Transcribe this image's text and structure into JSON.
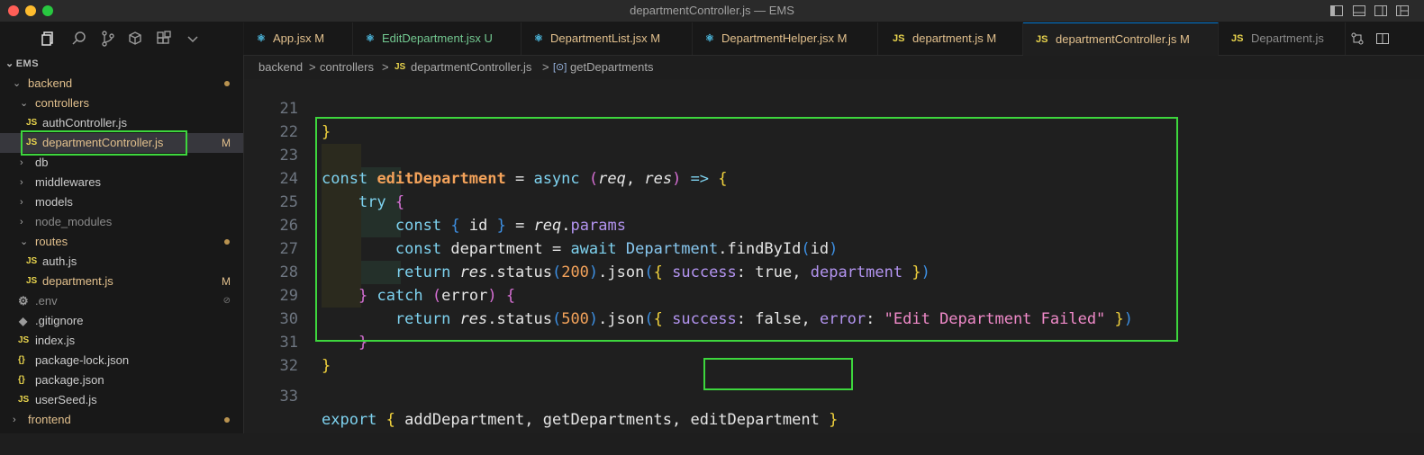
{
  "window": {
    "title": "departmentController.js — EMS"
  },
  "explorer": {
    "workspace": "EMS",
    "items": [
      {
        "label": "backend",
        "kind": "folder",
        "open": true,
        "status": "dot"
      },
      {
        "label": "controllers",
        "kind": "folder",
        "open": true
      },
      {
        "label": "authController.js",
        "kind": "js",
        "file_icon": "JS"
      },
      {
        "label": "departmentController.js",
        "kind": "js",
        "file_icon": "JS",
        "status": "M"
      },
      {
        "label": "db",
        "kind": "folder",
        "open": false
      },
      {
        "label": "middlewares",
        "kind": "folder",
        "open": false
      },
      {
        "label": "models",
        "kind": "folder",
        "open": false
      },
      {
        "label": "node_modules",
        "kind": "folder",
        "open": false
      },
      {
        "label": "routes",
        "kind": "folder",
        "open": true,
        "status": "dot"
      },
      {
        "label": "auth.js",
        "kind": "js",
        "file_icon": "JS"
      },
      {
        "label": "department.js",
        "kind": "js",
        "file_icon": "JS",
        "status": "M"
      },
      {
        "label": ".env",
        "kind": "gear",
        "status": "⊘"
      },
      {
        "label": ".gitignore",
        "kind": "git"
      },
      {
        "label": "index.js",
        "kind": "js",
        "file_icon": "JS"
      },
      {
        "label": "package-lock.json",
        "kind": "json",
        "file_icon": "{}"
      },
      {
        "label": "package.json",
        "kind": "json",
        "file_icon": "{}"
      },
      {
        "label": "userSeed.js",
        "kind": "js",
        "file_icon": "JS"
      },
      {
        "label": "frontend",
        "kind": "folder",
        "open": false,
        "status": "dot"
      }
    ]
  },
  "tabs": [
    {
      "label": "App.jsx",
      "status": "M",
      "icon": "react-icon"
    },
    {
      "label": "EditDepartment.jsx",
      "status": "U",
      "icon": "react-icon"
    },
    {
      "label": "DepartmentList.jsx",
      "status": "M",
      "icon": "react-icon"
    },
    {
      "label": "DepartmentHelper.jsx",
      "status": "M",
      "icon": "react-icon"
    },
    {
      "label": "department.js",
      "status": "M",
      "icon": "js-icon",
      "icon_text": "JS"
    },
    {
      "label": "departmentController.js",
      "status": "M",
      "icon": "js-icon",
      "icon_text": "JS",
      "active": true
    },
    {
      "label": "Department.js",
      "status": "",
      "icon": "js-icon",
      "icon_text": "JS"
    }
  ],
  "breadcrumb": {
    "parts": [
      "backend",
      "controllers",
      "departmentController.js",
      "getDepartments"
    ],
    "sep": ">",
    "file_icon": "JS",
    "symbol_icon": "[⊙]"
  },
  "code": {
    "line_numbers": [
      "21",
      "22",
      "23",
      "24",
      "25",
      "26",
      "27",
      "28",
      "29",
      "30",
      "31",
      "32",
      "33"
    ],
    "line21": "}",
    "line23": {
      "const": "const",
      "name": "editDepartment",
      "eq": " = ",
      "async": "async",
      "p1": "req",
      "p2": "res",
      "arrow": "=>"
    },
    "line24": "try",
    "line25": {
      "const": "const",
      "id": "id",
      "req": "req",
      "params": "params"
    },
    "line26": {
      "const": "const",
      "var": "department",
      "await": "await",
      "cls": "Department",
      "method": "findById",
      "arg": "id"
    },
    "line27": {
      "ret": "return",
      "res": "res",
      "status": "status",
      "code": "200",
      "json": "json",
      "key": "success",
      "val": "true",
      "key2": "department"
    },
    "line28": {
      "catch": "catch",
      "err": "error"
    },
    "line29": {
      "ret": "return",
      "res": "res",
      "status": "status",
      "code": "500",
      "json": "json",
      "key": "success",
      "val": "false",
      "key2": "error",
      "msg": "\"Edit Department Failed\""
    },
    "line33": {
      "export": "export",
      "a": "addDepartment",
      "b": "getDepartments",
      "c": "editDepartment"
    }
  },
  "colors": {
    "accent": "#0078d4",
    "highlight": "#3dd63d",
    "modified": "#e2c08d"
  }
}
